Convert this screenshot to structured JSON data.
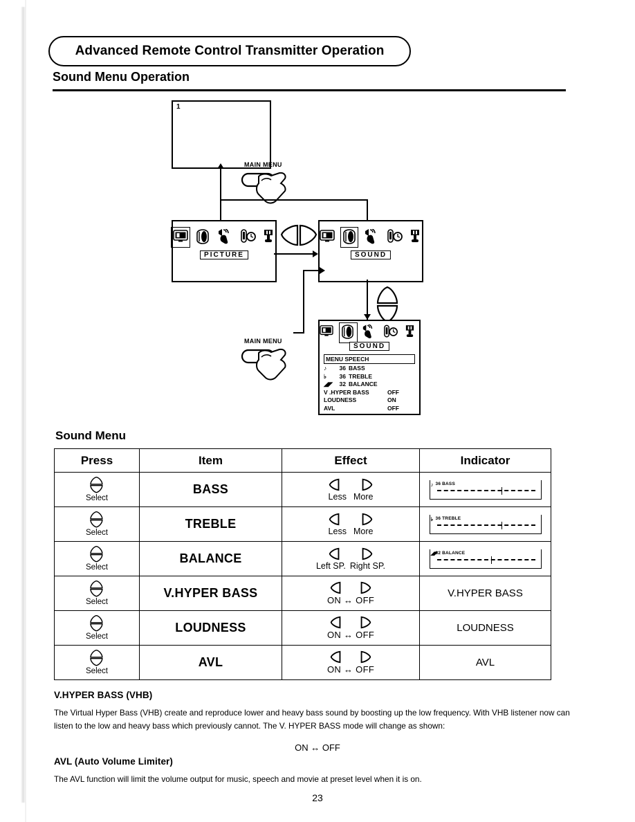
{
  "header": {
    "banner_title": "Advanced Remote Control Transmitter Operation",
    "section_title": "Sound Menu Operation"
  },
  "diagram": {
    "screen1_number": "1",
    "main_menu_label_top": "MAIN MENU",
    "main_menu_label_bottom": "MAIN MENU",
    "picture_screen": {
      "menu_label": "PICTURE",
      "icons": [
        "picture-icon",
        "sound-icon",
        "speech-icon",
        "timer-icon",
        "setup-icon"
      ],
      "selected_icon_index": 0
    },
    "sound_screen": {
      "menu_label": "SOUND",
      "icons": [
        "picture-icon",
        "sound-icon",
        "speech-icon",
        "timer-icon",
        "setup-icon"
      ],
      "selected_icon_index": 1
    },
    "sound_detail_screen": {
      "menu_label": "SOUND",
      "highlighted_row": "MENU SPEECH",
      "rows": [
        {
          "glyph": "bass-note-icon",
          "value": "36",
          "name": "BASS",
          "setting": ""
        },
        {
          "glyph": "treble-note-icon",
          "value": "36",
          "name": "TREBLE",
          "setting": ""
        },
        {
          "glyph": "balance-icon",
          "value": "32",
          "name": "BALANCE",
          "setting": ""
        },
        {
          "glyph": "",
          "value": "",
          "name": "V .HYPER BASS",
          "setting": "OFF"
        },
        {
          "glyph": "",
          "value": "",
          "name": "LOUDNESS",
          "setting": "ON"
        },
        {
          "glyph": "",
          "value": "",
          "name": "AVL",
          "setting": "OFF"
        }
      ]
    }
  },
  "sound_menu": {
    "title": "Sound Menu",
    "columns": [
      "Press",
      "Item",
      "Effect",
      "Indicator"
    ],
    "press_label": "Select",
    "rows": [
      {
        "item": "BASS",
        "effect_left": "Less",
        "effect_right": "More",
        "effect_type": "pair",
        "indicator_type": "bar",
        "indicator_glyph": "bass-note-icon",
        "indicator_text": "36 BASS",
        "indicator_tick_percent": 66
      },
      {
        "item": "TREBLE",
        "effect_left": "Less",
        "effect_right": "More",
        "effect_type": "pair",
        "indicator_type": "bar",
        "indicator_glyph": "treble-note-icon",
        "indicator_text": "36 TREBLE",
        "indicator_tick_percent": 66
      },
      {
        "item": "BALANCE",
        "effect_left": "Left SP.",
        "effect_right": "Right SP.",
        "effect_type": "pair",
        "indicator_type": "bar",
        "indicator_glyph": "balance-icon",
        "indicator_text": "32 BALANCE",
        "indicator_tick_percent": 57
      },
      {
        "item": "V.HYPER BASS",
        "effect_onoff": "ON ↔ OFF",
        "effect_type": "onoff",
        "indicator_type": "word",
        "indicator_text": "V.HYPER BASS"
      },
      {
        "item": "LOUDNESS",
        "effect_onoff": "ON ↔ OFF",
        "effect_type": "onoff",
        "indicator_type": "word",
        "indicator_text": "LOUDNESS"
      },
      {
        "item": "AVL",
        "effect_onoff": "ON ↔ OFF",
        "effect_type": "onoff",
        "indicator_type": "word",
        "indicator_text": "AVL"
      }
    ]
  },
  "notes": {
    "vhb_heading": "V.HYPER BASS (VHB)",
    "vhb_body": "The Virtual Hyper Bass (VHB) create and reproduce lower and heavy bass sound by boosting up the low frequency. With VHB listener now can listen to the low and heavy bass which previously cannot. The V. HYPER BASS mode will change as shown:",
    "vhb_toggle": "ON ↔ OFF",
    "avl_heading": "AVL (Auto Volume Limiter)",
    "avl_body": "The AVL function will limit the volume output for music, speech and movie at preset level when it is on."
  },
  "page_number": "23"
}
